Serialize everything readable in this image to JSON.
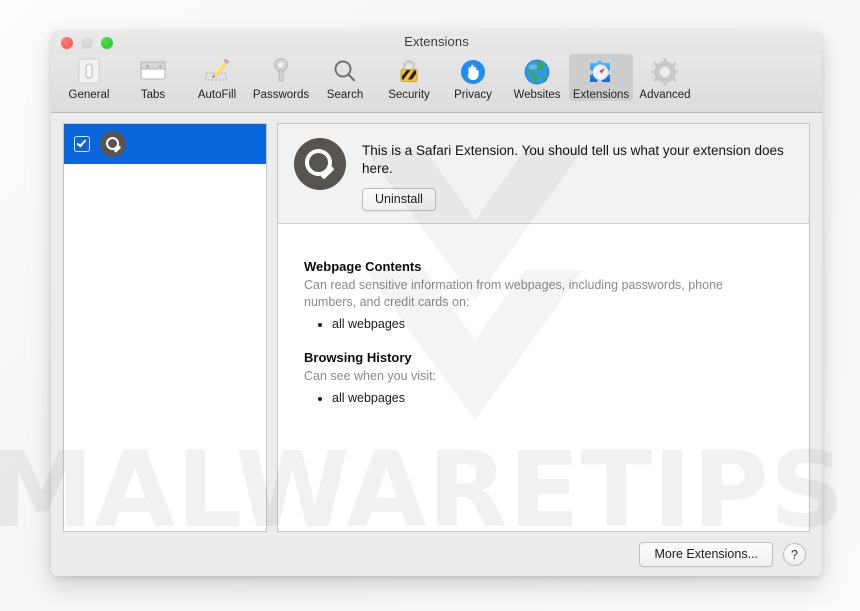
{
  "window": {
    "title": "Extensions",
    "traffic_lights": [
      {
        "name": "close",
        "color": "#f4524a"
      },
      {
        "name": "minimize",
        "color": "#cfcfcf"
      },
      {
        "name": "zoom",
        "color": "#21c521"
      }
    ]
  },
  "toolbar": {
    "items": [
      {
        "label": "General",
        "icon": "general-icon",
        "selected": false
      },
      {
        "label": "Tabs",
        "icon": "tabs-icon",
        "selected": false
      },
      {
        "label": "AutoFill",
        "icon": "autofill-icon",
        "selected": false
      },
      {
        "label": "Passwords",
        "icon": "passwords-icon",
        "selected": false
      },
      {
        "label": "Search",
        "icon": "search-icon",
        "selected": false
      },
      {
        "label": "Security",
        "icon": "security-icon",
        "selected": false
      },
      {
        "label": "Privacy",
        "icon": "privacy-icon",
        "selected": false
      },
      {
        "label": "Websites",
        "icon": "websites-icon",
        "selected": false
      },
      {
        "label": "Extensions",
        "icon": "extensions-icon",
        "selected": true
      },
      {
        "label": "Advanced",
        "icon": "advanced-icon",
        "selected": false
      }
    ]
  },
  "sidebar": {
    "extensions": [
      {
        "name": "",
        "icon": "magnifier-icon",
        "checked": true,
        "selected": true
      }
    ]
  },
  "detail": {
    "icon": "magnifier-icon",
    "description": "This is a Safari Extension. You should tell us what your extension does here.",
    "uninstall_label": "Uninstall",
    "permissions": [
      {
        "title": "Webpage Contents",
        "description": "Can read sensitive information from webpages, including passwords, phone numbers, and credit cards on:",
        "items": [
          "all webpages"
        ]
      },
      {
        "title": "Browsing History",
        "description": "Can see when you visit:",
        "items": [
          "all webpages"
        ]
      }
    ]
  },
  "footer": {
    "more_extensions_label": "More Extensions...",
    "help_label": "?"
  },
  "watermark": {
    "text": "MALWARETIPS"
  },
  "colors": {
    "selection_blue": "#0a66dd",
    "toolbar_selected": "#cdcdcd",
    "window_chrome": "#ececec",
    "muted_text": "#8b8b8b"
  }
}
